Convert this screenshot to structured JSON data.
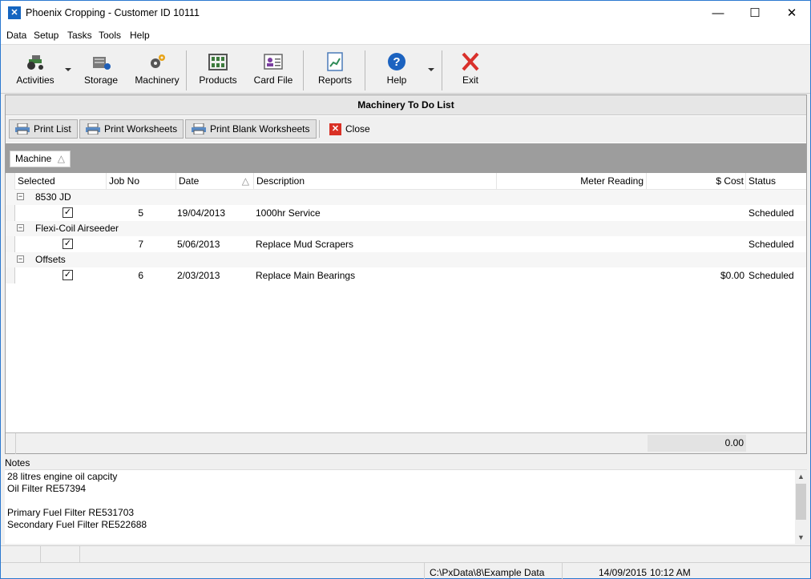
{
  "window": {
    "title": "Phoenix Cropping - Customer ID 10111",
    "minimize": "—",
    "maximize": "☐",
    "close": "✕"
  },
  "menu": [
    "Data",
    "Setup",
    "Tasks",
    "Tools",
    "Help"
  ],
  "toolbar": {
    "activities": "Activities",
    "storage": "Storage",
    "machinery": "Machinery",
    "products": "Products",
    "card_file": "Card File",
    "reports": "Reports",
    "help": "Help",
    "exit": "Exit"
  },
  "panel": {
    "title": "Machinery To Do List",
    "print_list": "Print List",
    "print_worksheets": "Print Worksheets",
    "print_blank_worksheets": "Print Blank Worksheets",
    "close": "Close",
    "group_by": "Machine",
    "sort_glyph": "△",
    "columns": {
      "selected": "Selected",
      "job_no": "Job No",
      "date": "Date",
      "description": "Description",
      "meter_reading": "Meter Reading",
      "cost": "$ Cost",
      "status": "Status"
    },
    "groups": [
      {
        "name": "8530 JD",
        "row": {
          "job_no": "5",
          "date": "19/04/2013",
          "description": "1000hr Service",
          "meter": "",
          "cost": "",
          "status": "Scheduled"
        }
      },
      {
        "name": "Flexi-Coil Airseeder",
        "row": {
          "job_no": "7",
          "date": "5/06/2013",
          "description": "Replace Mud Scrapers",
          "meter": "",
          "cost": "",
          "status": "Scheduled"
        }
      },
      {
        "name": "Offsets",
        "row": {
          "job_no": "6",
          "date": "2/03/2013",
          "description": "Replace Main Bearings",
          "meter": "",
          "cost": "$0.00",
          "status": "Scheduled"
        }
      }
    ],
    "total_cost": "0.00"
  },
  "notes": {
    "label": "Notes",
    "lines": [
      "28 litres engine oil capcity",
      "Oil Filter RE57394",
      "",
      "Primary Fuel Filter RE531703",
      "Secondary Fuel Filter RE522688"
    ]
  },
  "status": {
    "path": "C:\\PxData\\8\\Example Data",
    "date": "14/09/2015",
    "time": "10:12 AM"
  }
}
